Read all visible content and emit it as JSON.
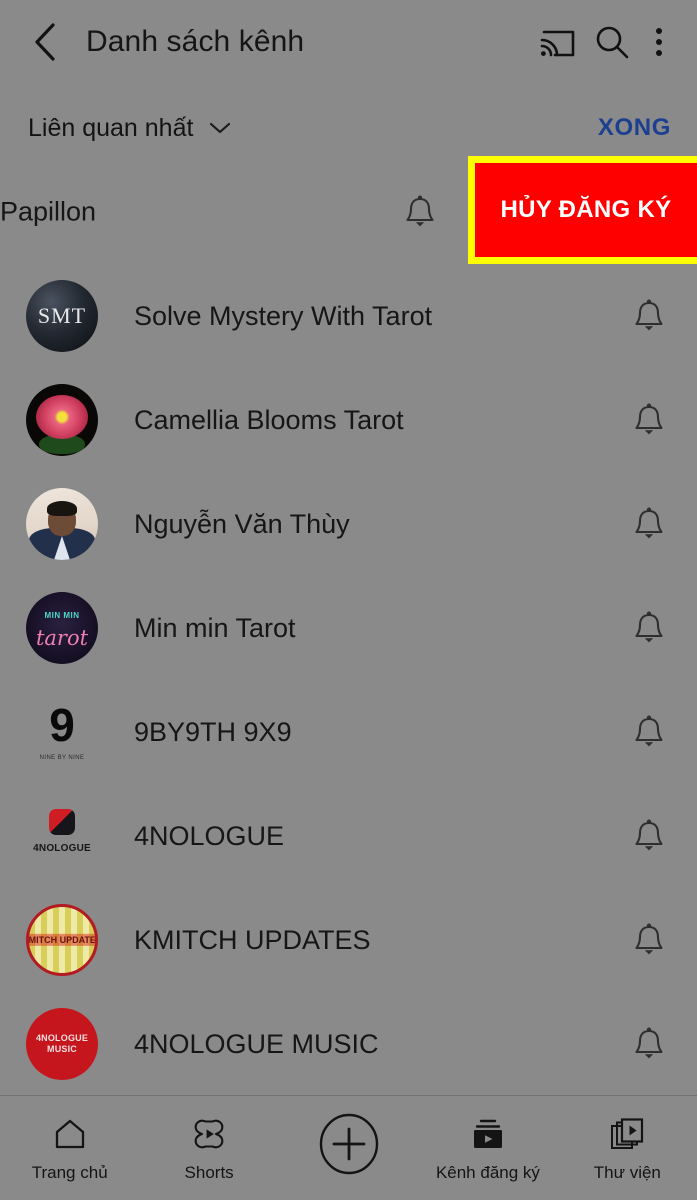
{
  "appbar": {
    "back_icon": "chevron-left-icon",
    "title": "Danh sách kênh",
    "cast_icon": "cast-icon",
    "search_icon": "search-icon",
    "overflow_icon": "more-vertical-icon"
  },
  "sortbar": {
    "sort_label": "Liên quan nhất",
    "chevron_icon": "chevron-down-icon",
    "done_label": "XONG"
  },
  "partial_row": {
    "name": "Papillon",
    "bell_icon": "bell-icon",
    "unsubscribe_label": "HỦY ĐĂNG KÝ",
    "highlight_color": "#ffff00",
    "button_color": "#ff0000",
    "button_text_color": "#ffffff"
  },
  "colors": {
    "background": "#8a8a8a",
    "text": "#161616",
    "done_blue": "#1d3f8f",
    "highlight_yellow": "#ffff00",
    "unsubscribe_red": "#ff0000"
  },
  "channels": [
    {
      "name": "Solve Mystery With Tarot",
      "avatar_name": "avatar-solve-mystery-with-tarot",
      "avatar_text": "SMT",
      "bell_icon": "bell-icon"
    },
    {
      "name": "Camellia Blooms Tarot",
      "avatar_name": "avatar-camellia-blooms-tarot",
      "avatar_text": "",
      "bell_icon": "bell-icon"
    },
    {
      "name": "Nguyễn Văn Thùy",
      "avatar_name": "avatar-nguyen-van-thuy",
      "avatar_text": "",
      "bell_icon": "bell-icon"
    },
    {
      "name": "Min min Tarot",
      "avatar_name": "avatar-min-min-tarot",
      "avatar_text": "MIN MIN",
      "avatar_script": "tarot",
      "bell_icon": "bell-icon"
    },
    {
      "name": "9BY9TH 9X9",
      "avatar_name": "avatar-9by9th-9x9",
      "avatar_text": "9",
      "avatar_sub": "NINE BY NINE",
      "bell_icon": "bell-icon"
    },
    {
      "name": "4NOLOGUE",
      "avatar_name": "avatar-4nologue",
      "avatar_text": "4NOLOGUE",
      "bell_icon": "bell-icon"
    },
    {
      "name": "KMITCH UPDATES",
      "avatar_name": "avatar-kmitch-updates",
      "avatar_text": "KMITCH UPDATES",
      "bell_icon": "bell-icon"
    },
    {
      "name": "4NOLOGUE MUSIC",
      "avatar_name": "avatar-4nologue-music",
      "avatar_text": "4NOLOGUE MUSIC",
      "bell_icon": "bell-icon"
    }
  ],
  "bottomnav": [
    {
      "label": "Trang chủ",
      "icon": "home-icon"
    },
    {
      "label": "Shorts",
      "icon": "shorts-icon"
    },
    {
      "label": "",
      "icon": "plus-circle-icon"
    },
    {
      "label": "Kênh đăng ký",
      "icon": "subscriptions-icon"
    },
    {
      "label": "Thư viện",
      "icon": "library-icon"
    }
  ]
}
